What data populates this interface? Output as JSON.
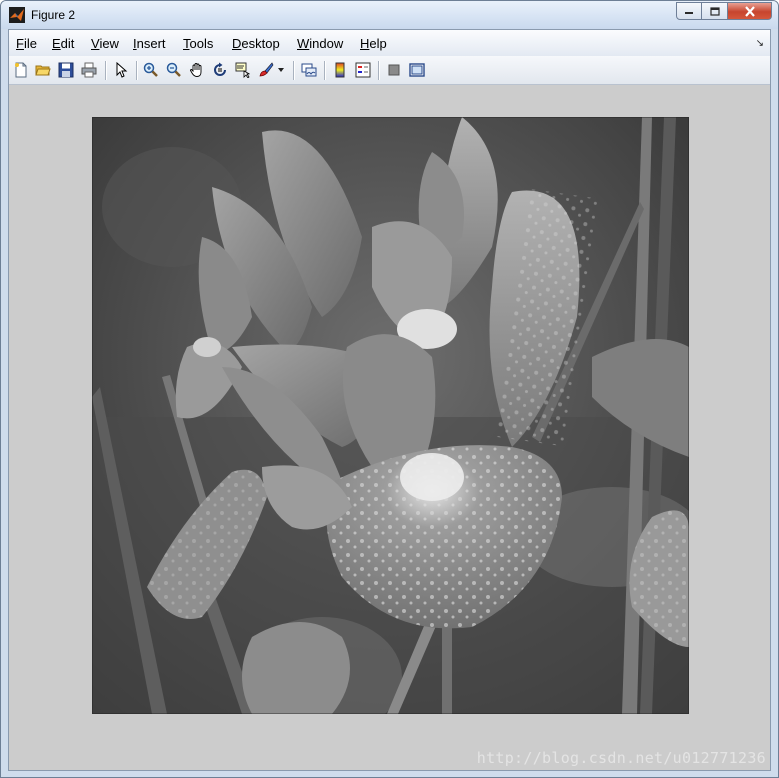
{
  "window": {
    "title": "Figure 2"
  },
  "menubar": {
    "items": [
      "File",
      "Edit",
      "View",
      "Insert",
      "Tools",
      "Desktop",
      "Window",
      "Help"
    ]
  },
  "toolbar": {
    "buttons": [
      {
        "name": "new-figure",
        "icon": "new-document-icon"
      },
      {
        "name": "open-file",
        "icon": "folder-open-icon"
      },
      {
        "name": "save-figure",
        "icon": "floppy-disk-icon"
      },
      {
        "name": "print-figure",
        "icon": "printer-icon"
      },
      {
        "name": "edit-plot",
        "icon": "pointer-arrow-icon"
      },
      {
        "name": "zoom-in",
        "icon": "zoom-in-icon"
      },
      {
        "name": "zoom-out",
        "icon": "zoom-out-icon"
      },
      {
        "name": "pan",
        "icon": "hand-icon"
      },
      {
        "name": "rotate-3d",
        "icon": "rotate-icon"
      },
      {
        "name": "data-cursor",
        "icon": "data-cursor-icon"
      },
      {
        "name": "brush",
        "icon": "brush-icon"
      },
      {
        "name": "link-plot",
        "icon": "link-plot-icon"
      },
      {
        "name": "insert-colorbar",
        "icon": "colorbar-icon"
      },
      {
        "name": "insert-legend",
        "icon": "legend-icon"
      },
      {
        "name": "hide-plot-tools",
        "icon": "hide-plot-tools-icon"
      },
      {
        "name": "show-plot-tools",
        "icon": "show-plot-tools-icon"
      }
    ]
  },
  "figure": {
    "image_content": "grayscale iris flower with water droplets"
  },
  "watermark": "http://blog.csdn.net/u012771236",
  "colors": {
    "figure_background": "#cccccc",
    "titlebar": "#dbe6f4",
    "close_button": "#c7452e"
  }
}
